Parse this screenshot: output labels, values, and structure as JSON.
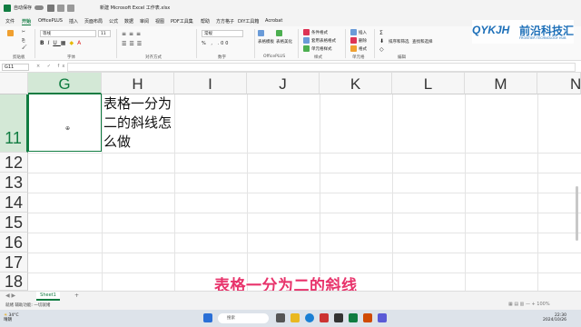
{
  "titlebar": {
    "autosave": "自动保存",
    "filename": "新建 Microsoft Excel 工作表.xlsx",
    "toggle": "off"
  },
  "menu": {
    "items": [
      "文件",
      "开始",
      "OfficePLUS",
      "插入",
      "页面布局",
      "公式",
      "数据",
      "审阅",
      "视图",
      "PDF工具集",
      "帮助",
      "方方格子",
      "DIY工具箱",
      "Acrobat"
    ],
    "active_index": 1
  },
  "ribbon": {
    "font_name": "等线",
    "font_size": "11",
    "number_format": "常规",
    "groups": [
      "剪贴板",
      "字体",
      "对齐方式",
      "数字",
      "OfficePLUS",
      "样式",
      "单元格",
      "编辑"
    ],
    "style_items": [
      "条件格式",
      "套用表格格式",
      "单元格样式"
    ],
    "cell_items": [
      "插入",
      "删除",
      "格式"
    ],
    "officeplus_items": [
      "表格模板",
      "表格美化"
    ],
    "edit_items": [
      "排序和筛选",
      "查找和选择"
    ]
  },
  "logo": {
    "mark": "QYKJH",
    "name": "前沿科技汇",
    "sub": "FRONTIER TECHNOLOGY HUB"
  },
  "formula_bar": {
    "name_box": "G11",
    "fx": "×  ✓  fx",
    "content": ""
  },
  "sheet": {
    "columns": [
      "G",
      "H",
      "I",
      "J",
      "K",
      "L",
      "M",
      "N"
    ],
    "rows": [
      "11",
      "12",
      "13",
      "14",
      "15",
      "16",
      "17",
      "18"
    ],
    "selected_column": "G",
    "selected_row": "11",
    "cell_text": "表格一分为二的斜线怎么做"
  },
  "subtitle": "表格一分为二的斜线",
  "sheet_tabs": [
    "Sheet1"
  ],
  "status": {
    "left": "就绪   辅助功能: 一切就绪"
  },
  "taskbar": {
    "weather_temp": "34°C",
    "weather_desc": "晴朗",
    "search_placeholder": "搜索",
    "time": "22:30",
    "date": "2024/10/26"
  }
}
